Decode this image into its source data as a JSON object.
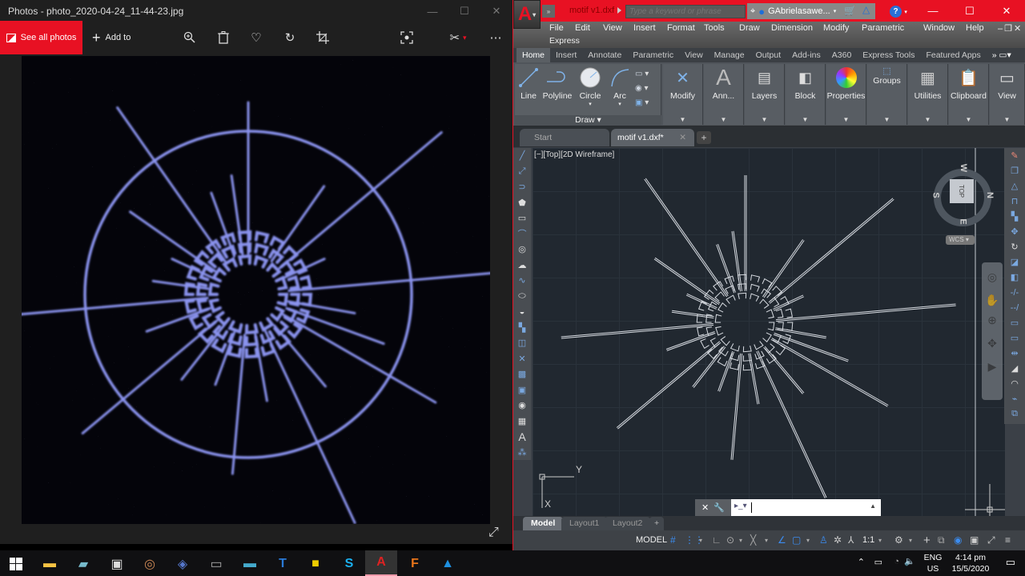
{
  "photos": {
    "title": "Photos - photo_2020-04-24_11-44-23.jpg",
    "toolbar": {
      "see_all_label": "See all photos",
      "add_to_label": "Add to",
      "icons": [
        "zoom-in-icon",
        "delete-icon",
        "favorite-icon",
        "rotate-icon",
        "crop-icon",
        "slideshow-icon",
        "edit-draw-icon",
        "more-icon"
      ]
    },
    "window_buttons": {
      "minimize": "—",
      "maximize": "☐",
      "close": "✕"
    },
    "image": {
      "description": "Photo of a radial circuit-like motif with rays inside a circle, blue-violet on black",
      "stroke_color": "#8a93ee",
      "background_color": "#04040a"
    }
  },
  "autocad": {
    "app_letter": "A",
    "document_title": "motif v1.dxf",
    "search_placeholder": "Type a keyword or phrase",
    "user_name": "GAbrielasawe...",
    "menu": [
      "File",
      "Edit",
      "View",
      "Insert",
      "Format",
      "Tools",
      "Draw",
      "Dimension",
      "Modify",
      "Parametric",
      "Window",
      "Help",
      "Express"
    ],
    "ribbon_tabs": [
      "Home",
      "Insert",
      "Annotate",
      "Parametric",
      "View",
      "Manage",
      "Output",
      "Add-ins",
      "A360",
      "Express Tools",
      "Featured Apps"
    ],
    "active_ribbon_tab": "Home",
    "draw_panel": {
      "tools": [
        "Line",
        "Polyline",
        "Circle",
        "Arc"
      ],
      "label": "Draw ▾"
    },
    "ribbon_panels": [
      "Modify",
      "Ann...",
      "Layers",
      "Block",
      "Properties",
      "Groups",
      "Utilities",
      "Clipboard",
      "View"
    ],
    "doc_tabs": [
      {
        "label": "Start",
        "active": false
      },
      {
        "label": "motif v1.dxf*",
        "active": true
      }
    ],
    "viewport_label": "[−][Top][2D Wireframe]",
    "viewcube": {
      "face": "TOP",
      "north": "N",
      "south": "S",
      "east": "E",
      "west": "W"
    },
    "ucs_label": "WCS",
    "axis_labels": {
      "x": "X",
      "y": "Y"
    },
    "layout_tabs": [
      "Model",
      "Layout1",
      "Layout2"
    ],
    "active_layout": "Model",
    "status": {
      "model": "MODEL",
      "scale": "1:1"
    }
  },
  "taskbar": {
    "apps": [
      "start",
      "file-explorer",
      "notepad-pad",
      "remote-desktop",
      "media-player",
      "app-blue",
      "terminal",
      "magnifier",
      "typora",
      "sticky-notes",
      "skype",
      "autocad",
      "fusion",
      "photos"
    ],
    "language": {
      "line1": "ENG",
      "line2": "US"
    },
    "time": "4:14 pm",
    "date": "15/5/2020"
  }
}
